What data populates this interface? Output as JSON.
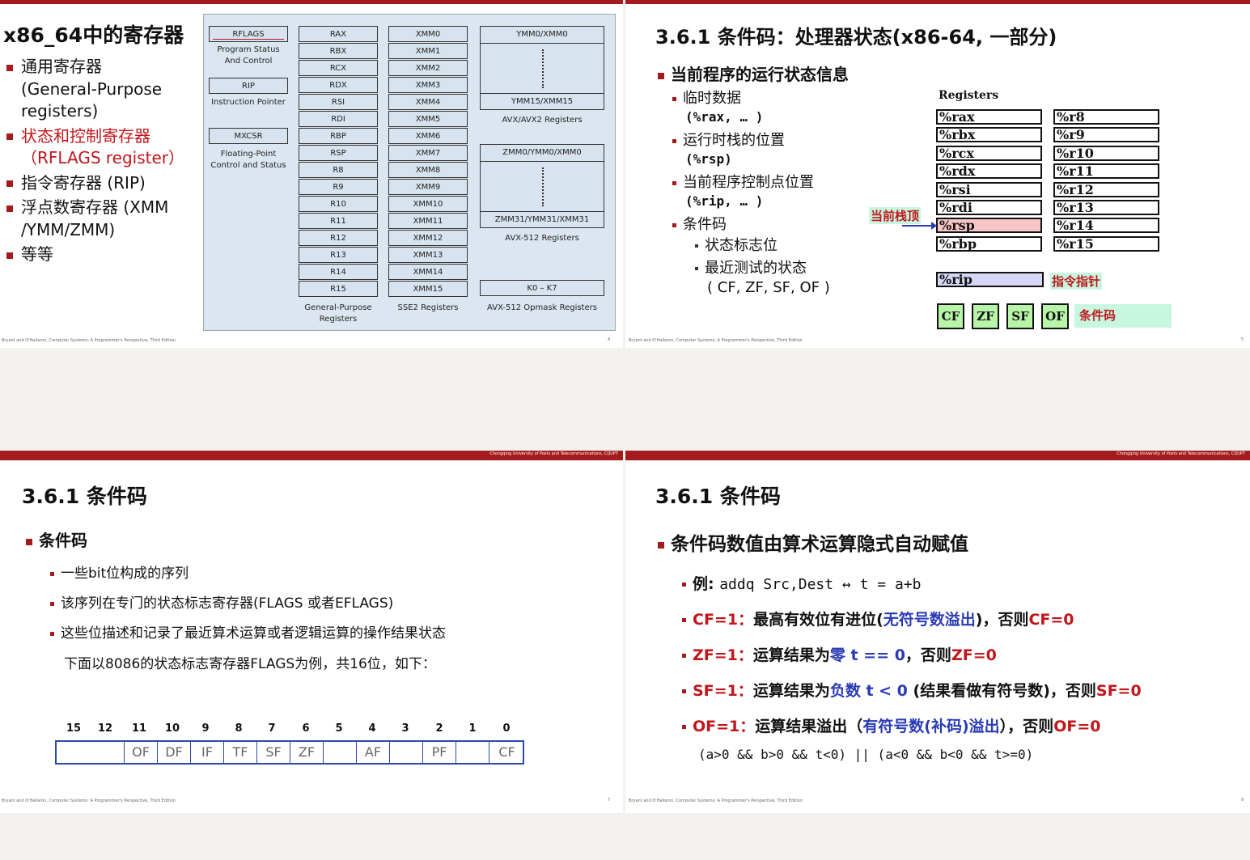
{
  "slide1": {
    "title": "x86_64中的寄存器",
    "bullets": [
      {
        "lines": [
          "通用寄存器",
          "(General-Purpose",
          "registers)"
        ],
        "color": "#111111"
      },
      {
        "lines": [
          "状态和控制寄存器",
          "（RFLAGS register）"
        ],
        "color": "#c0161c"
      },
      {
        "lines": [
          "指令寄存器 (RIP)"
        ],
        "color": "#111111"
      },
      {
        "lines": [
          "浮点数寄存器 (XMM",
          "/YMM/ZMM)"
        ],
        "color": "#111111"
      },
      {
        "lines": [
          "等等"
        ],
        "color": "#111111"
      }
    ],
    "diagram": {
      "rflags": "RFLAGS",
      "rflags_desc": [
        "Program Status",
        "And Control"
      ],
      "rip": "RIP",
      "rip_desc": "Instruction Pointer",
      "mxcsr": "MXCSR",
      "mxcsr_desc": [
        "Floating-Point",
        "Control and Status"
      ],
      "gp": [
        "RAX",
        "RBX",
        "RCX",
        "RDX",
        "RSI",
        "RDI",
        "RBP",
        "RSP",
        "R8",
        "R9",
        "R10",
        "R11",
        "R12",
        "R13",
        "R14",
        "R15"
      ],
      "gp_label": [
        "General-Purpose",
        "Registers"
      ],
      "xmm": [
        "XMM0",
        "XMM1",
        "XMM2",
        "XMM3",
        "XMM4",
        "XMM5",
        "XMM6",
        "XMM7",
        "XMM8",
        "XMM9",
        "XMM10",
        "XMM11",
        "XMM12",
        "XMM13",
        "XMM14",
        "XMM15"
      ],
      "xmm_label": "SSE2 Registers",
      "ymm_top": "YMM0/XMM0",
      "ymm_bottom": "YMM15/XMM15",
      "ymm_label": "AVX/AVX2 Registers",
      "zmm_top": "ZMM0/YMM0/XMM0",
      "zmm_bottom": "ZMM31/YMM31/XMM31",
      "zmm_label": "AVX-512 Registers",
      "opmask": "K0 – K7",
      "opmask_label": "AVX-512 Opmask Registers"
    },
    "footer": "Bryant and O'Hallaron, Computer Systems: A Programmer's Perspective, Third Edition",
    "page": "4"
  },
  "slide2": {
    "title": "3.6.1 条件码：处理器状态(x86-64, 一部分)",
    "main_bullet": "当前程序的运行状态信息",
    "items": [
      {
        "text": "临时数据",
        "sub": "(%rax, … )"
      },
      {
        "text": "运行时栈的位置",
        "sub": "(%rsp)"
      },
      {
        "text": "当前程序控制点位置",
        "sub": "(%rip, … )"
      },
      {
        "text": "条件码",
        "sub": ""
      }
    ],
    "subitems": [
      "状态标志位",
      "最近测试的状态",
      "( CF, ZF, SF, OF )"
    ],
    "registers_label": "Registers",
    "regs_left": [
      "%rax",
      "%rbx",
      "%rcx",
      "%rdx",
      "%rsi",
      "%rdi",
      "%rsp",
      "%rbp"
    ],
    "regs_right": [
      "%r8",
      "%r9",
      "%r10",
      "%r11",
      "%r12",
      "%r13",
      "%r14",
      "%r15"
    ],
    "stack_top_label": "当前栈顶",
    "rip": "%rip",
    "rip_label": "指令指针",
    "flags": [
      "CF",
      "ZF",
      "SF",
      "OF"
    ],
    "flags_label": "条件码",
    "colors": {
      "rsp": "#f6c6c6",
      "rip": "#d6d6f6",
      "flag": "#b8f5a8",
      "label_bg": "#c8f7e0"
    },
    "footer": "Bryant and O'Hallaron, Computer Systems: A Programmer's Perspective, Third Edition",
    "page": "5"
  },
  "slide3": {
    "institution": "Chongqing University of Posts and Telecommunications, CQUPT",
    "title": "3.6.1 条件码",
    "main_bullet": "条件码",
    "items": [
      "一些bit位构成的序列",
      "该序列在专门的状态标志寄存器(FLAGS 或者EFLAGS)",
      "这些位描述和记录了最近算术运算或者逻辑运算的操作结果状态"
    ],
    "note": "下面以8086的状态标志寄存器FLAGS为例，共16位，如下：",
    "bit_numbers": [
      "15",
      "12",
      "11",
      "10",
      "9",
      "8",
      "7",
      "6",
      "5",
      "4",
      "3",
      "2",
      "1",
      "0"
    ],
    "bit_cells": [
      "",
      "OF",
      "DF",
      "IF",
      "TF",
      "SF",
      "ZF",
      "",
      "AF",
      "",
      "PF",
      "",
      "CF"
    ],
    "footer": "Bryant and O'Hallaron, Computer Systems: A Programmer's Perspective, Third Edition",
    "page": "7"
  },
  "slide4": {
    "institution": "Chongqing University of Posts and Telecommunications, CQUPT",
    "title": "3.6.1 条件码",
    "main_bullet": "条件码数值由算术运算隐式自动赋值",
    "example": {
      "prefix": "例: ",
      "code": "addq Src,Dest ↔ t = a+b"
    },
    "cf": {
      "flag": "CF=1：",
      "text1": "最高有效位有进位(",
      "blue": "无符号数溢出",
      "text2": ")，否则",
      "tail": "CF=0"
    },
    "zf": {
      "flag": "ZF=1：",
      "text1": "运算结果为",
      "blue": "零 t == 0",
      "text2": "，否则",
      "tail": "ZF=0"
    },
    "sf": {
      "flag": "SF=1：",
      "text1": "运算结果为",
      "blue": "负数 t < 0",
      "text2": " (结果看做有符号数)，否则",
      "tail": "SF=0"
    },
    "of": {
      "flag": "OF=1：",
      "text1": "运算结果溢出（",
      "blue": "有符号数(补码)溢出",
      "text2": "），否则",
      "tail": "OF=0"
    },
    "of_condition": "(a>0 && b>0 && t<0) || (a<0 && b<0 && t>=0)",
    "footer": "Bryant and O'Hallaron, Computer Systems: A Programmer's Perspective, Third Edition",
    "page": "9"
  }
}
